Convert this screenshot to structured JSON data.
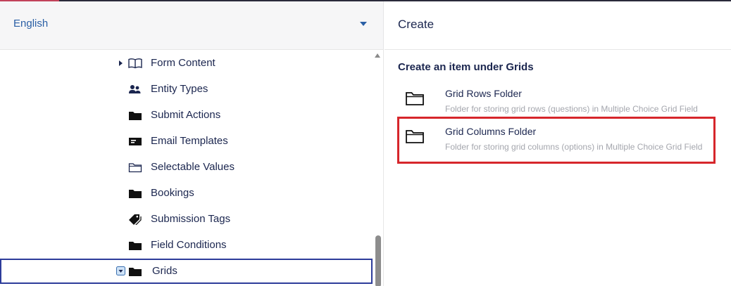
{
  "language": {
    "selected": "English"
  },
  "tree": {
    "items": [
      {
        "label": "Form Content",
        "icon": "book-icon",
        "expandable": true
      },
      {
        "label": "Entity Types",
        "icon": "users-icon"
      },
      {
        "label": "Submit Actions",
        "icon": "folder-icon"
      },
      {
        "label": "Email Templates",
        "icon": "id-card-icon"
      },
      {
        "label": "Selectable Values",
        "icon": "folder-outline-icon"
      },
      {
        "label": "Bookings",
        "icon": "folder-icon"
      },
      {
        "label": "Submission Tags",
        "icon": "tags-icon"
      },
      {
        "label": "Field Conditions",
        "icon": "folder-icon"
      },
      {
        "label": "Grids",
        "icon": "folder-icon",
        "selected": true,
        "expanded": true
      }
    ]
  },
  "create_panel": {
    "title": "Create",
    "section_title": "Create an item under Grids",
    "items": [
      {
        "name": "Grid Rows Folder",
        "description": "Folder for storing grid rows (questions) in Multiple Choice Grid Field",
        "icon": "folder-outline-icon"
      },
      {
        "name": "Grid Columns Folder",
        "description": "Folder for storing grid columns (options) in Multiple Choice Grid Field",
        "icon": "folder-outline-icon",
        "highlighted": true
      }
    ]
  },
  "colors": {
    "accent_blue": "#2a5fa5",
    "selection_border": "#2d3c9a",
    "highlight_red": "#d6262b",
    "text_dark": "#1b264f",
    "text_muted": "#a4a6ad"
  }
}
